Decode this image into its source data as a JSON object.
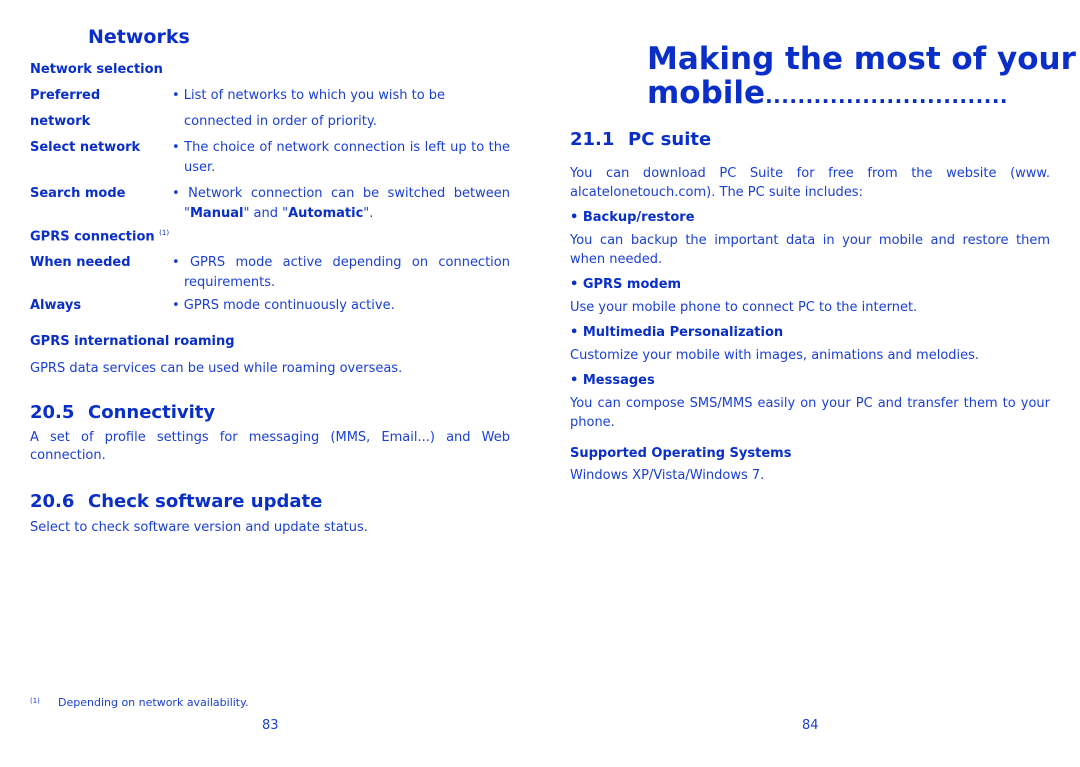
{
  "left_page": {
    "networks_heading": "Networks",
    "network_selection_heading": "Network selection",
    "network_selection_items": [
      {
        "label_line1": "Preferred",
        "label_line2": "network",
        "desc_line1": "• List of networks to which you wish to be",
        "desc_line2": "connected in order of priority."
      },
      {
        "label": "Select network",
        "desc": "• The choice of network connection is left up to the user."
      },
      {
        "label": "Search mode",
        "desc_pre": "• Network connection can be switched between \"",
        "desc_b1": "Manual",
        "desc_mid": "\" and \"",
        "desc_b2": "Automatic",
        "desc_post": "\"."
      }
    ],
    "gprs_connection_heading": "GPRS connection",
    "gprs_connection_footnote_mark": "(1)",
    "gprs_connection_items": [
      {
        "label": "When needed",
        "desc": "• GPRS mode active depending on connection requirements."
      },
      {
        "label": "Always",
        "desc": "• GPRS mode continuously active."
      }
    ],
    "gprs_roaming_heading": "GPRS international roaming",
    "gprs_roaming_text": "GPRS data services can be used while roaming overseas.",
    "section_20_5": {
      "number": "20.5",
      "title": "Connectivity",
      "text": "A set of profile settings for messaging (MMS, Email...) and Web connection."
    },
    "section_20_6": {
      "number": "20.6",
      "title": "Check software update",
      "text": "Select to check software version and update status."
    },
    "footnote": {
      "mark": "(1)",
      "text": "Depending on network availability."
    },
    "page_number": "83"
  },
  "right_page": {
    "chapter_title_line1": "Making the most of your",
    "chapter_title_line2": "mobile",
    "chapter_title_leader": "..............................",
    "section_21_1": {
      "number": "21.1",
      "title": "PC suite"
    },
    "intro_text": "You can download PC Suite for free from the website (www. alcatelonetouch.com). The PC suite includes:",
    "features": [
      {
        "title": "• Backup/restore",
        "text": "You can backup the important data in your mobile and restore them when needed."
      },
      {
        "title": "• GPRS modem",
        "text": "Use your mobile phone to connect PC to the internet."
      },
      {
        "title": "• Multimedia Personalization",
        "text": "Customize your mobile with images, animations and melodies."
      },
      {
        "title": "• Messages",
        "text": "You can compose SMS/MMS easily on your PC and transfer them to your phone."
      }
    ],
    "supported_os_heading": "Supported Operating Systems",
    "supported_os_text": "Windows XP/Vista/Windows 7.",
    "page_number": "84"
  }
}
